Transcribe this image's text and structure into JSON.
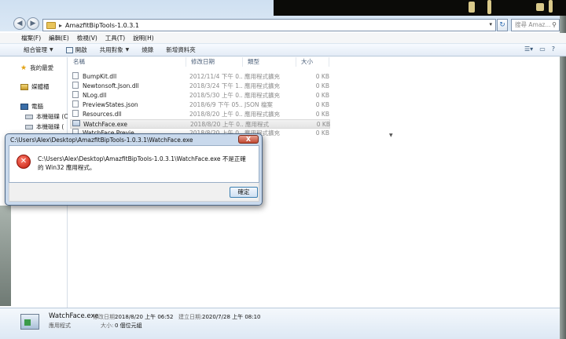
{
  "address": {
    "path": "AmazfitBipTools-1.0.3.1",
    "search_placeholder": "搜尋 Amaz..."
  },
  "menu": [
    "檔案(F)",
    "編輯(E)",
    "檢視(V)",
    "工具(T)",
    "說明(H)"
  ],
  "toolbar": {
    "organize": "組合管理",
    "open": "開啟",
    "share": "共用對象",
    "burn": "燒錄",
    "new_folder": "新增資料夾"
  },
  "nav": {
    "favorites": "我的最愛",
    "libraries": "媒體櫃",
    "computer": "電腦",
    "drive_c": "本機磁碟 (C",
    "drive_d": "本機磁碟 ("
  },
  "columns": {
    "name": "名稱",
    "date": "修改日期",
    "type": "類型",
    "size": "大小"
  },
  "files": [
    {
      "name": "BumpKit.dll",
      "date": "2012/11/4 下午 0...",
      "type": "應用程式擴充",
      "size": "0 KB",
      "icon": "dll-icon"
    },
    {
      "name": "Newtonsoft.Json.dll",
      "date": "2018/3/24 下午 1...",
      "type": "應用程式擴充",
      "size": "0 KB",
      "icon": "dll-icon"
    },
    {
      "name": "NLog.dll",
      "date": "2018/5/30 上午 0...",
      "type": "應用程式擴充",
      "size": "0 KB",
      "icon": "dll-icon"
    },
    {
      "name": "PreviewStates.json",
      "date": "2018/6/9 下午 05...",
      "type": "JSON 檔案",
      "size": "0 KB",
      "icon": "json-icon"
    },
    {
      "name": "Resources.dll",
      "date": "2018/8/20 上午 0...",
      "type": "應用程式擴充",
      "size": "0 KB",
      "icon": "dll-icon"
    },
    {
      "name": "WatchFace.exe",
      "date": "2018/8/20 上午 0...",
      "type": "應用程式",
      "size": "0 KB",
      "icon": "exe-icon"
    },
    {
      "name": "WatchFace.Previe...",
      "date": "2018/8/20 上午 0...",
      "type": "應用程式擴充",
      "size": "0 KB",
      "icon": "dll-icon"
    }
  ],
  "details": {
    "name": "WatchFace.exe",
    "type": "應用程式",
    "modified_label": "修改日期:",
    "modified_value": "2018/8/20 上午 06:52",
    "created_label": "建立日期:",
    "created_value": "2020/7/28 上午 08:10",
    "size_label": "大小:",
    "size_value": "0 個位元組"
  },
  "dialog": {
    "title": "C:\\Users\\Alex\\Desktop\\AmazfitBipTools-1.0.3.1\\WatchFace.exe",
    "close": "X",
    "message": "C:\\Users\\Alex\\Desktop\\AmazfitBipTools-1.0.3.1\\WatchFace.exe 不是正確的 Win32 應用程式。",
    "ok": "確定"
  }
}
